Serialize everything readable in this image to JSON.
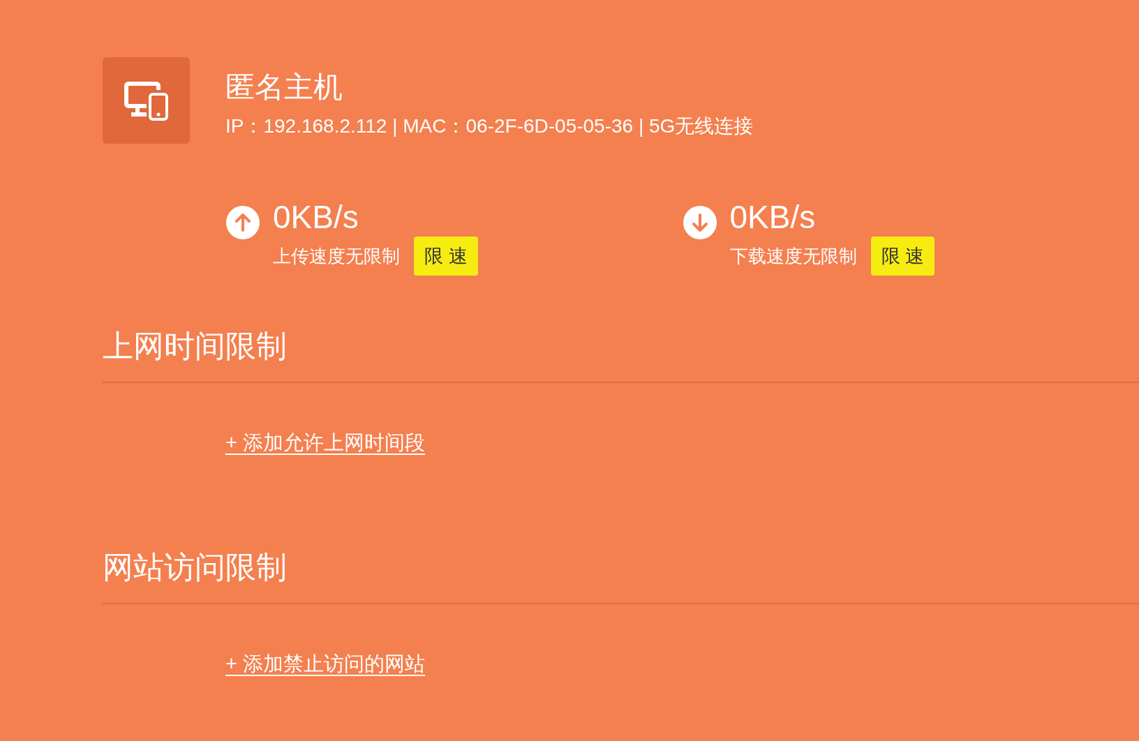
{
  "device": {
    "name": "匿名主机",
    "info": "IP：192.168.2.112 | MAC：06-2F-6D-05-05-36 | 5G无线连接"
  },
  "speeds": [
    {
      "kind": "upload",
      "value": "0KB/s",
      "status": "上传速度无限制",
      "button": "限 速"
    },
    {
      "kind": "download",
      "value": "0KB/s",
      "status": "下载速度无限制",
      "button": "限 速"
    }
  ],
  "sections": [
    {
      "title": "上网时间限制",
      "link": "+ 添加允许上网时间段"
    },
    {
      "title": "网站访问限制",
      "link": "+ 添加禁止访问的网站"
    }
  ]
}
